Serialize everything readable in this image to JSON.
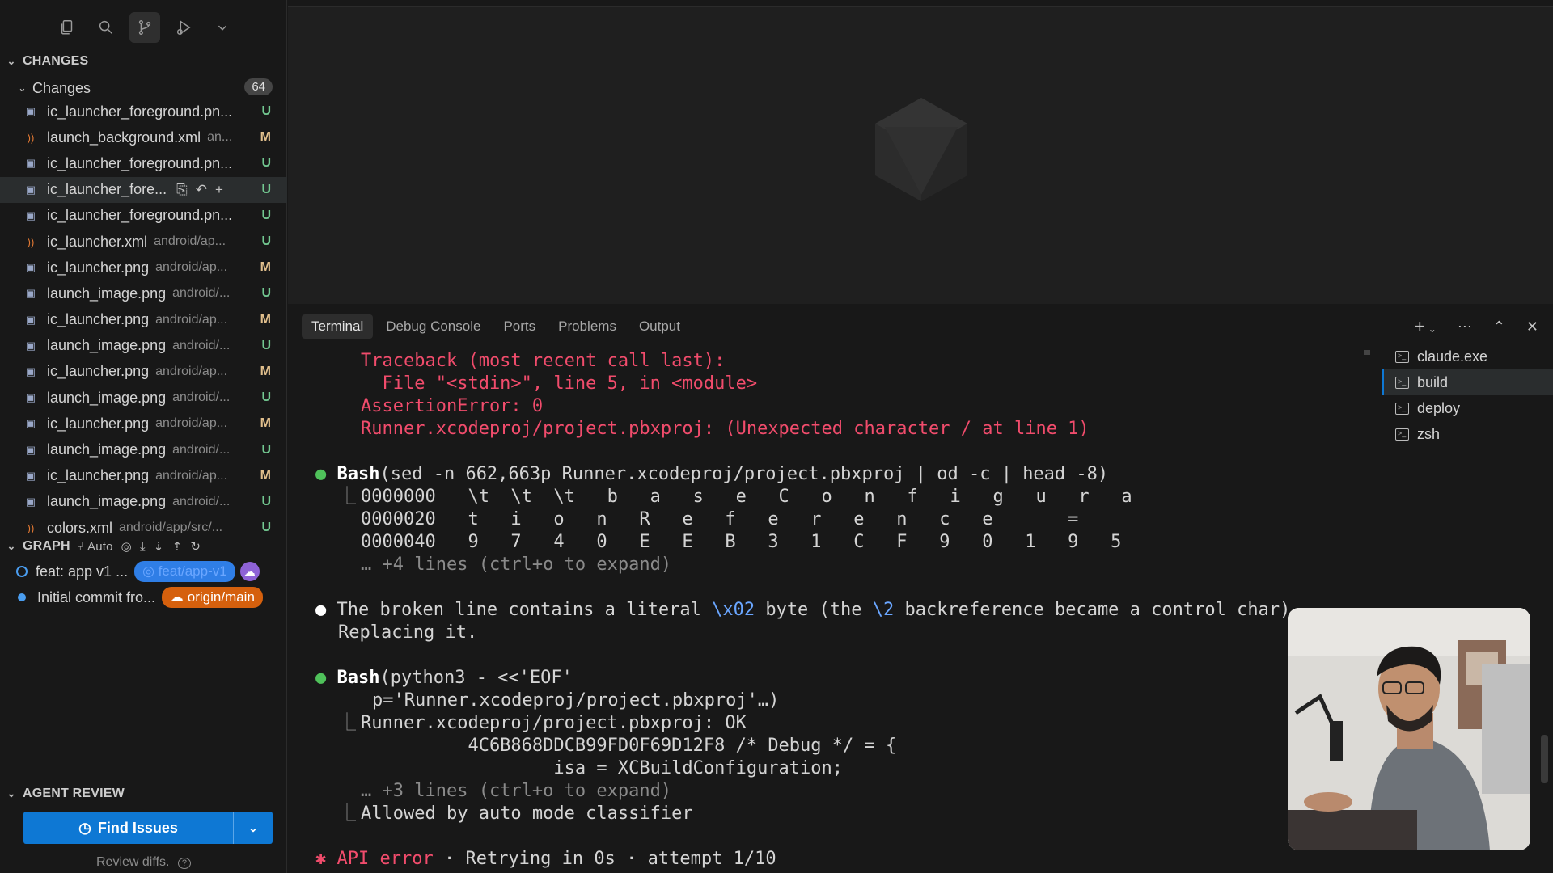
{
  "sidebar": {
    "toolbar_icons": [
      "explorer-icon",
      "search-icon",
      "source-control-icon",
      "run-debug-icon",
      "chevron-down-icon"
    ],
    "changes_section": "CHANGES",
    "changes_group": "Changes",
    "changes_count": "64",
    "files": [
      {
        "name": "ic_launcher_foreground.pn...",
        "dir": "",
        "status": "U",
        "type": "img"
      },
      {
        "name": "launch_background.xml",
        "dir": "an...",
        "status": "M",
        "type": "xml"
      },
      {
        "name": "ic_launcher_foreground.pn...",
        "dir": "",
        "status": "U",
        "type": "img"
      },
      {
        "name": "ic_launcher_fore...",
        "dir": "",
        "status": "U",
        "type": "img"
      },
      {
        "name": "ic_launcher_foreground.pn...",
        "dir": "",
        "status": "U",
        "type": "img"
      },
      {
        "name": "ic_launcher.xml",
        "dir": "android/ap...",
        "status": "U",
        "type": "xml"
      },
      {
        "name": "ic_launcher.png",
        "dir": "android/ap...",
        "status": "M",
        "type": "img"
      },
      {
        "name": "launch_image.png",
        "dir": "android/...",
        "status": "U",
        "type": "img"
      },
      {
        "name": "ic_launcher.png",
        "dir": "android/ap...",
        "status": "M",
        "type": "img"
      },
      {
        "name": "launch_image.png",
        "dir": "android/...",
        "status": "U",
        "type": "img"
      },
      {
        "name": "ic_launcher.png",
        "dir": "android/ap...",
        "status": "M",
        "type": "img"
      },
      {
        "name": "launch_image.png",
        "dir": "android/...",
        "status": "U",
        "type": "img"
      },
      {
        "name": "ic_launcher.png",
        "dir": "android/ap...",
        "status": "M",
        "type": "img"
      },
      {
        "name": "launch_image.png",
        "dir": "android/...",
        "status": "U",
        "type": "img"
      },
      {
        "name": "ic_launcher.png",
        "dir": "android/ap...",
        "status": "M",
        "type": "img"
      },
      {
        "name": "launch_image.png",
        "dir": "android/...",
        "status": "U",
        "type": "img"
      },
      {
        "name": "colors.xml",
        "dir": "android/app/src/...",
        "status": "U",
        "type": "xml"
      }
    ],
    "graph": {
      "title": "GRAPH",
      "mode": "Auto",
      "commits": [
        {
          "message": "feat: app v1 ...",
          "branch": "feat/app-v1"
        },
        {
          "message": "Initial commit fro...",
          "branch": "origin/main"
        }
      ]
    },
    "agent_review": {
      "title": "AGENT REVIEW",
      "button": "Find Issues",
      "hint": "Review diffs."
    }
  },
  "panel": {
    "tabs": [
      "Terminal",
      "Debug Console",
      "Ports",
      "Problems",
      "Output"
    ],
    "active_tab": "Terminal",
    "terminals": [
      "claude.exe",
      "build",
      "deploy",
      "zsh"
    ],
    "selected_terminal": "build"
  },
  "terminal": {
    "traceback": [
      "Traceback (most recent call last):",
      "  File \"<stdin>\", line 5, in <module>",
      "AssertionError: 0",
      "Runner.xcodeproj/project.pbxproj: (Unexpected character / at line 1)"
    ],
    "bash1_tool": "Bash",
    "bash1_cmd": "(sed -n 662,663p Runner.xcodeproj/project.pbxproj | od -c | head -8)",
    "bash1_out": [
      "0000000   \\t  \\t  \\t   b   a   s   e   C   o   n   f   i   g   u   r   a",
      "0000020   t   i   o   n   R   e   f   e   r   e   n   c   e       =",
      "0000040   9   7   4   0   E   E   B   3   1   C   F   9   0   1   9   5"
    ],
    "bash1_more": "… +4 lines (ctrl+o to expand)",
    "msg_a": "The broken line contains a literal ",
    "msg_code1": "\\x02",
    "msg_b": " byte (the ",
    "msg_code2": "\\2",
    "msg_c": " backreference became a control char).",
    "msg_line2": "Replacing it.",
    "bash2_tool": "Bash",
    "bash2_cmd": "(python3 - <<'EOF'",
    "bash2_cmd2": "p='Runner.xcodeproj/project.pbxproj'…)",
    "bash2_out": [
      "Runner.xcodeproj/project.pbxproj: OK",
      "          4C6B868DDCB99FD0F69D12F8 /* Debug */ = {",
      "                  isa = XCBuildConfiguration;"
    ],
    "bash2_more": "… +3 lines (ctrl+o to expand)",
    "bash2_allowed": "Allowed by auto mode classifier",
    "api_error": "API error",
    "api_rest": " · Retrying in 0s · attempt 1/10"
  }
}
